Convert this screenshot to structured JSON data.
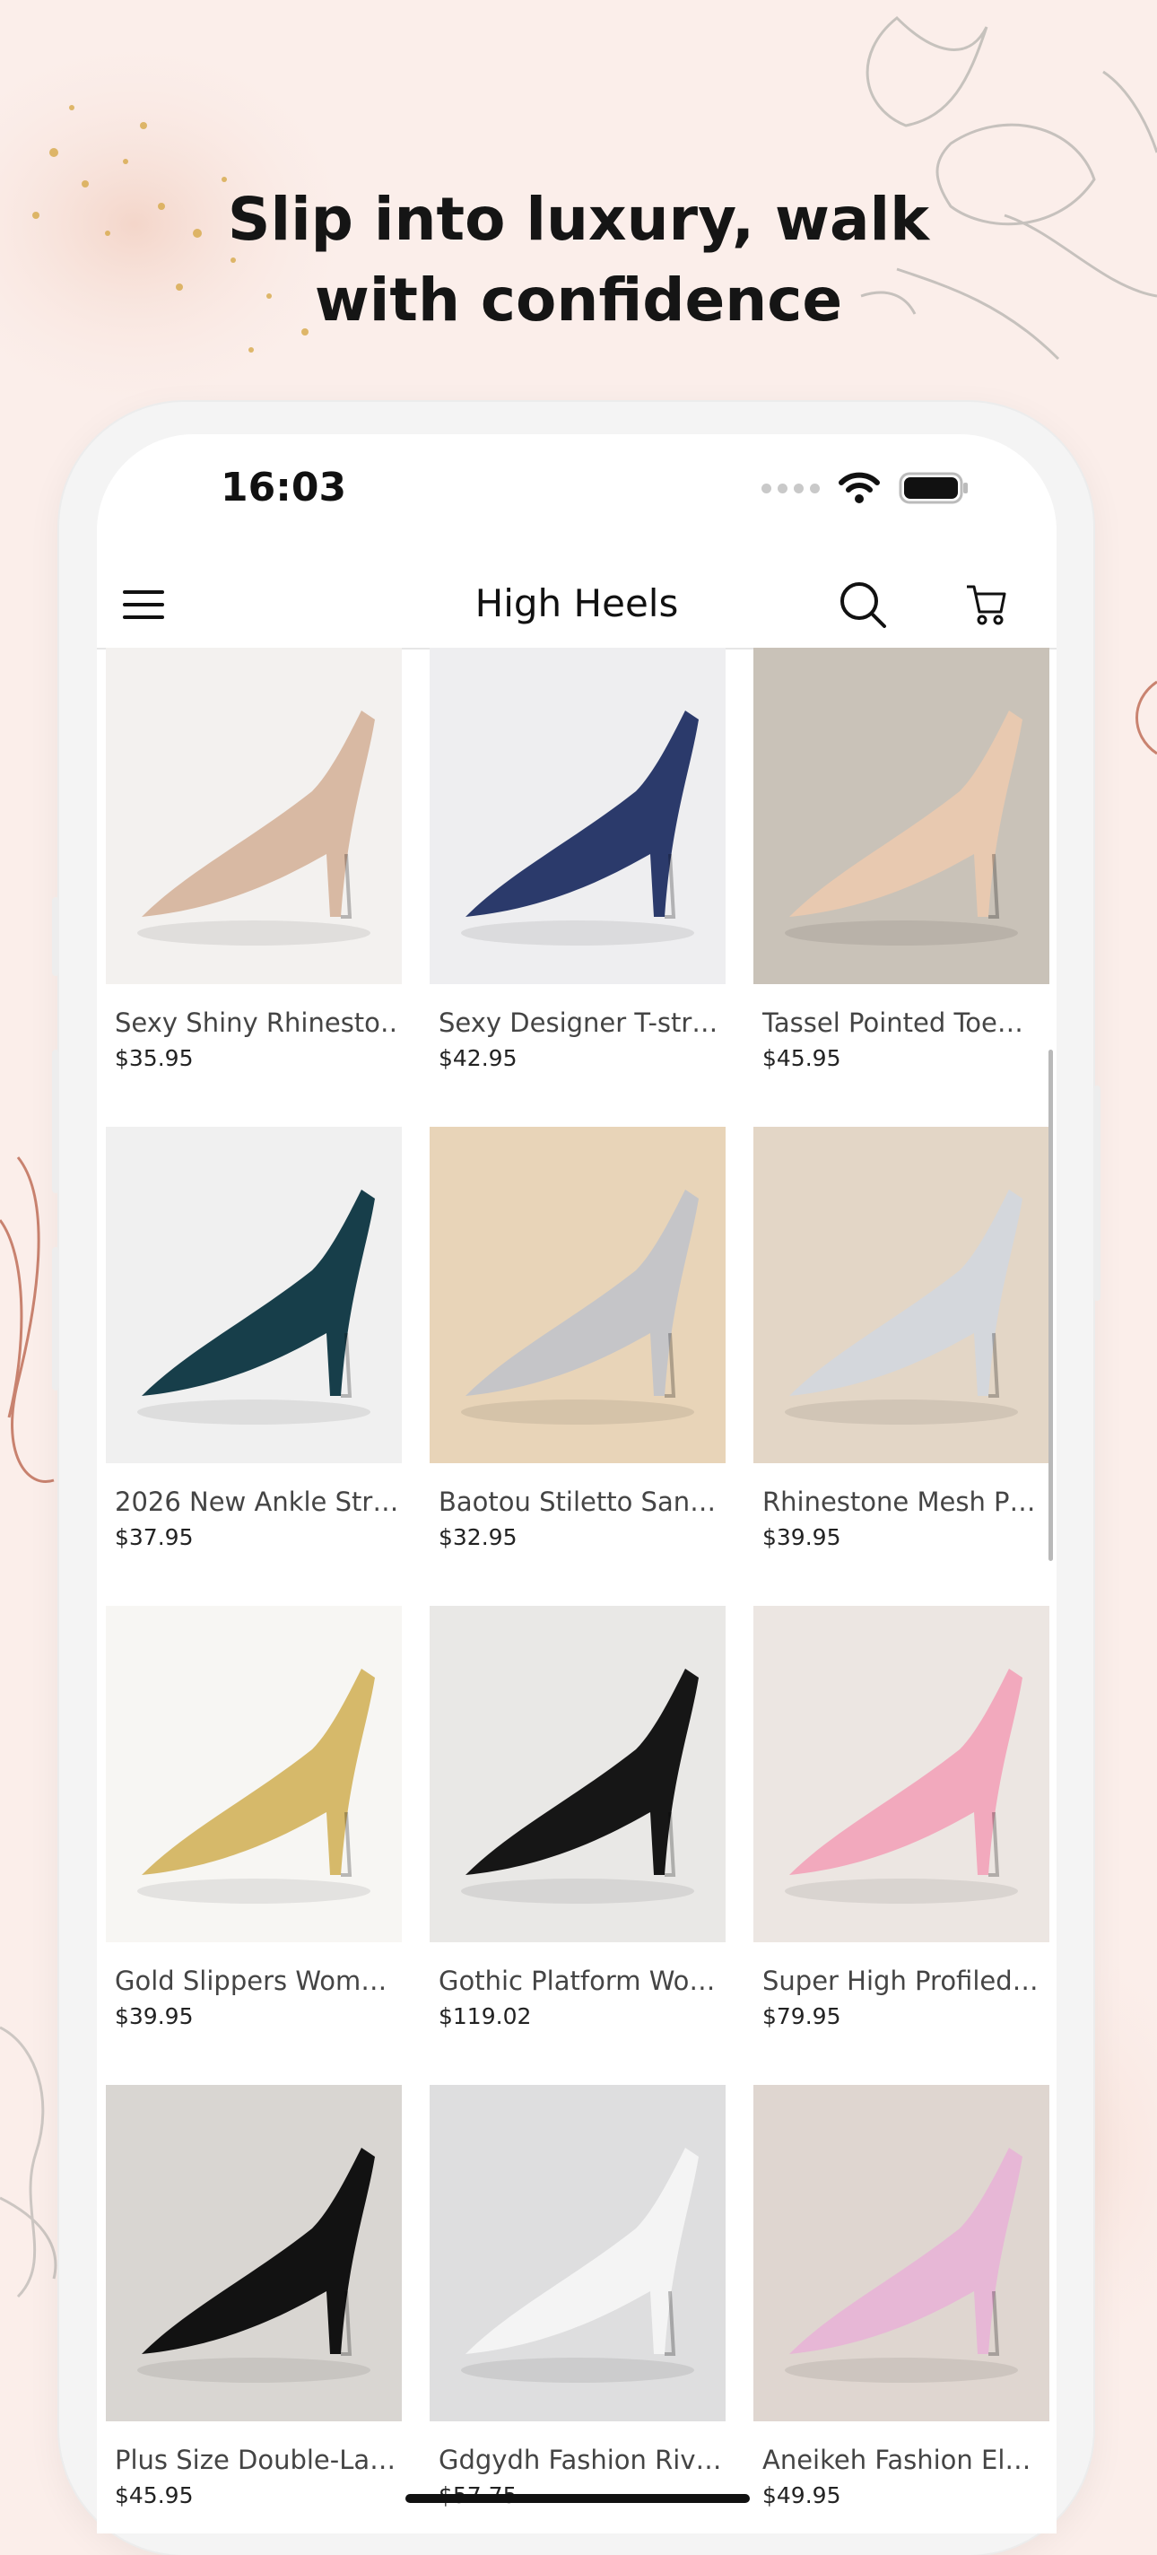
{
  "headline": {
    "line1": "Slip into luxury, walk",
    "line2": "with confidence"
  },
  "status_bar": {
    "time": "16:03",
    "icons": [
      "cellular-dots-icon",
      "wifi-icon",
      "battery-icon"
    ]
  },
  "nav": {
    "title": "High Heels",
    "icons": [
      "menu-icon",
      "search-icon",
      "cart-icon"
    ]
  },
  "products": [
    {
      "title": "Sexy Shiny Rhinesto…",
      "price": "$35.95",
      "bg": "#f3f1ef",
      "shoe": "#d8b9a3"
    },
    {
      "title": "Sexy Designer T-str…",
      "price": "$42.95",
      "bg": "#eeeef0",
      "shoe": "#2b3a6b"
    },
    {
      "title": "Tassel Pointed Toe…",
      "price": "$45.95",
      "bg": "#c9c2b8",
      "shoe": "#e8c9b0"
    },
    {
      "title": "2026 New Ankle Str…",
      "price": "$37.95",
      "bg": "#f0f0f0",
      "shoe": "#173e4a"
    },
    {
      "title": "Baotou Stiletto San…",
      "price": "$32.95",
      "bg": "#e8d4b8",
      "shoe": "#c5c5c8"
    },
    {
      "title": "Rhinestone Mesh P…",
      "price": "$39.95",
      "bg": "#e3d6c6",
      "shoe": "#d4d7dc"
    },
    {
      "title": "Gold Slippers Wom…",
      "price": "$39.95",
      "bg": "#f7f6f3",
      "shoe": "#d6b96a"
    },
    {
      "title": "Gothic Platform Wo…",
      "price": "$119.02",
      "bg": "#e9e8e6",
      "shoe": "#161616"
    },
    {
      "title": "Super High Profiled…",
      "price": "$79.95",
      "bg": "#ece6e2",
      "shoe": "#f2a9bd"
    },
    {
      "title": "Plus Size Double-La…",
      "price": "$45.95",
      "bg": "#d9d6d2",
      "shoe": "#121212"
    },
    {
      "title": "Gdgydh Fashion Riv…",
      "price": "$57.75",
      "bg": "#dededf",
      "shoe": "#f4f4f4"
    },
    {
      "title": "Aneikeh Fashion El…",
      "price": "$49.95",
      "bg": "#dfd6d0",
      "shoe": "#e7b7d6"
    }
  ]
}
